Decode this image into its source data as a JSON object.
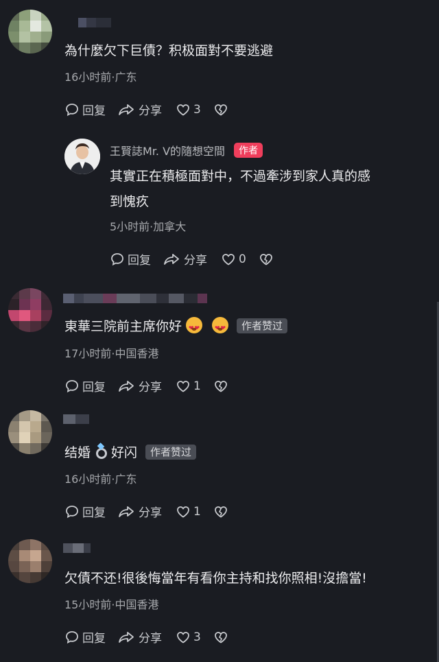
{
  "comments": [
    {
      "text": "為什麼欠下巨債？积极面對不要逃避",
      "meta": "16小时前·广东",
      "reply_label": "回复",
      "share_label": "分享",
      "like_count": "3",
      "reply": {
        "author": "王賢誌Mr. V的隨想空間",
        "author_badge": "作者",
        "text_line1": "其實正在積極面對中，不過牽涉到家人真的感",
        "text_line2": "到愧疚",
        "meta": "5小时前·加拿大",
        "reply_label": "回复",
        "share_label": "分享",
        "like_count": "0"
      }
    },
    {
      "text": "東華三院前主席你好",
      "liked_badge": "作者赞过",
      "meta": "17小时前·中国香港",
      "reply_label": "回复",
      "share_label": "分享",
      "like_count": "1"
    },
    {
      "text_before": "结婚",
      "text_after": "好闪",
      "liked_badge": "作者赞过",
      "meta": "16小时前·广东",
      "reply_label": "回复",
      "share_label": "分享",
      "like_count": "1"
    },
    {
      "text": "欠債不还!很後悔當年有看你主持和找你照相!沒擔當!",
      "meta": "15小时前·中国香港",
      "reply_label": "回复",
      "share_label": "分享",
      "like_count": "3"
    }
  ],
  "icons": {
    "reply": "speech-bubble-icon",
    "share": "share-arrow-icon",
    "like": "heart-icon",
    "dislike": "broken-heart-icon"
  },
  "colors": {
    "background": "#1a1c22",
    "author_badge": "#ef3e5c",
    "liked_badge": "#4a4d55"
  }
}
